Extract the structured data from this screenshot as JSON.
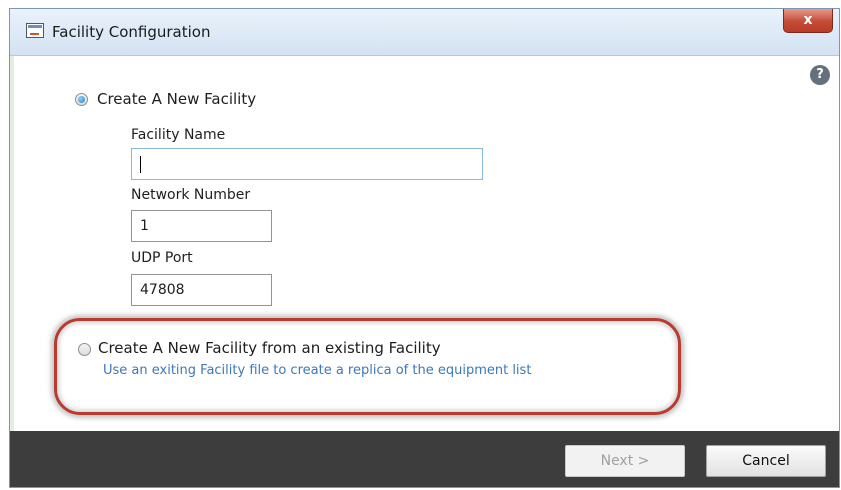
{
  "window": {
    "title": "Facility Configuration",
    "close_label": "x",
    "help_label": "?"
  },
  "option_new": {
    "label": "Create A New Facility",
    "selected": true,
    "facility_name": {
      "label": "Facility Name",
      "value": ""
    },
    "network_number": {
      "label": "Network Number",
      "value": "1"
    },
    "udp_port": {
      "label": "UDP Port",
      "value": "47808"
    }
  },
  "option_existing": {
    "label": "Create A New Facility from an existing Facility",
    "description": "Use an exiting Facility file to create a replica of the equipment list",
    "selected": false
  },
  "footer": {
    "next_label": "Next >",
    "next_enabled": false,
    "cancel_label": "Cancel"
  },
  "colors": {
    "footer_bg": "#3d3d3d",
    "highlight_ring": "#b83b2d",
    "link_text": "#3c78b9",
    "close_button": "#c44b36"
  }
}
